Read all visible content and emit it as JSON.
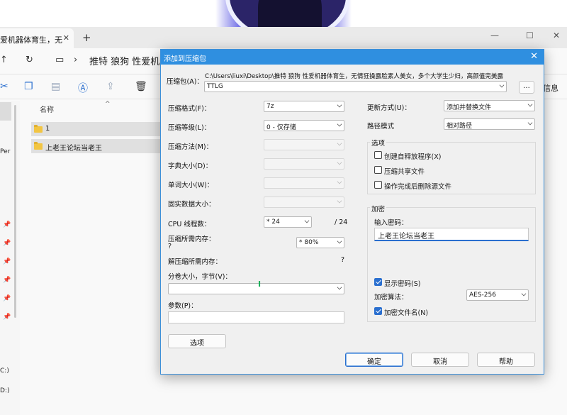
{
  "explorer": {
    "tab_title": "爱机器体育生，无",
    "address": "推特 狼狗 性爱机器",
    "toolbar_info": "信息",
    "column_name": "名称",
    "sidebar_texts": [
      "Per",
      "C:)",
      "D:)"
    ],
    "files": [
      "1",
      "上老王论坛当老王"
    ]
  },
  "dialog": {
    "title": "添加到压缩包",
    "archive_label": "压缩包(A)：",
    "archive_path": "C:\\Users\\liuxi\\Desktop\\推特 狼狗 性爱机器体育生，无情狂操露脸素人美女，多个大学生少妇，高颜值完美露",
    "archive_name": "TTLG",
    "browse_label": "...",
    "left": {
      "format_label": "压缩格式(F)：",
      "format_value": "7z",
      "level_label": "压缩等级(L)：",
      "level_value": "0 - 仅存储",
      "method_label": "压缩方法(M)：",
      "dict_label": "字典大小(D)：",
      "word_label": "单词大小(W)：",
      "solid_label": "固实数据大小：",
      "cpu_label": "CPU 线程数：",
      "cpu_value": "* 24",
      "cpu_total": "/ 24",
      "mem_label": "压缩所需内存：",
      "mem_value": "?",
      "mem_percent": "* 80%",
      "decomp_label": "解压缩所需内存：",
      "decomp_value": "?",
      "split_label": "分卷大小，字节(V)：",
      "params_label": "参数(P)："
    },
    "right": {
      "update_label": "更新方式(U)：",
      "update_value": "添加并替换文件",
      "path_label": "路径模式",
      "path_value": "相对路径",
      "options_title": "选项",
      "opt_sfx": "创建自释放程序(X)",
      "opt_shared": "压缩共享文件",
      "opt_delete": "操作完成后删除源文件",
      "encrypt_title": "加密",
      "password_label": "输入密码：",
      "password_value": "上老王论坛当老王",
      "show_password": "显示密码(S)",
      "enc_method_label": "加密算法：",
      "enc_method_value": "AES-256",
      "encrypt_names": "加密文件名(N)"
    },
    "buttons": {
      "options": "选项",
      "ok": "确定",
      "cancel": "取消",
      "help": "帮助"
    }
  }
}
